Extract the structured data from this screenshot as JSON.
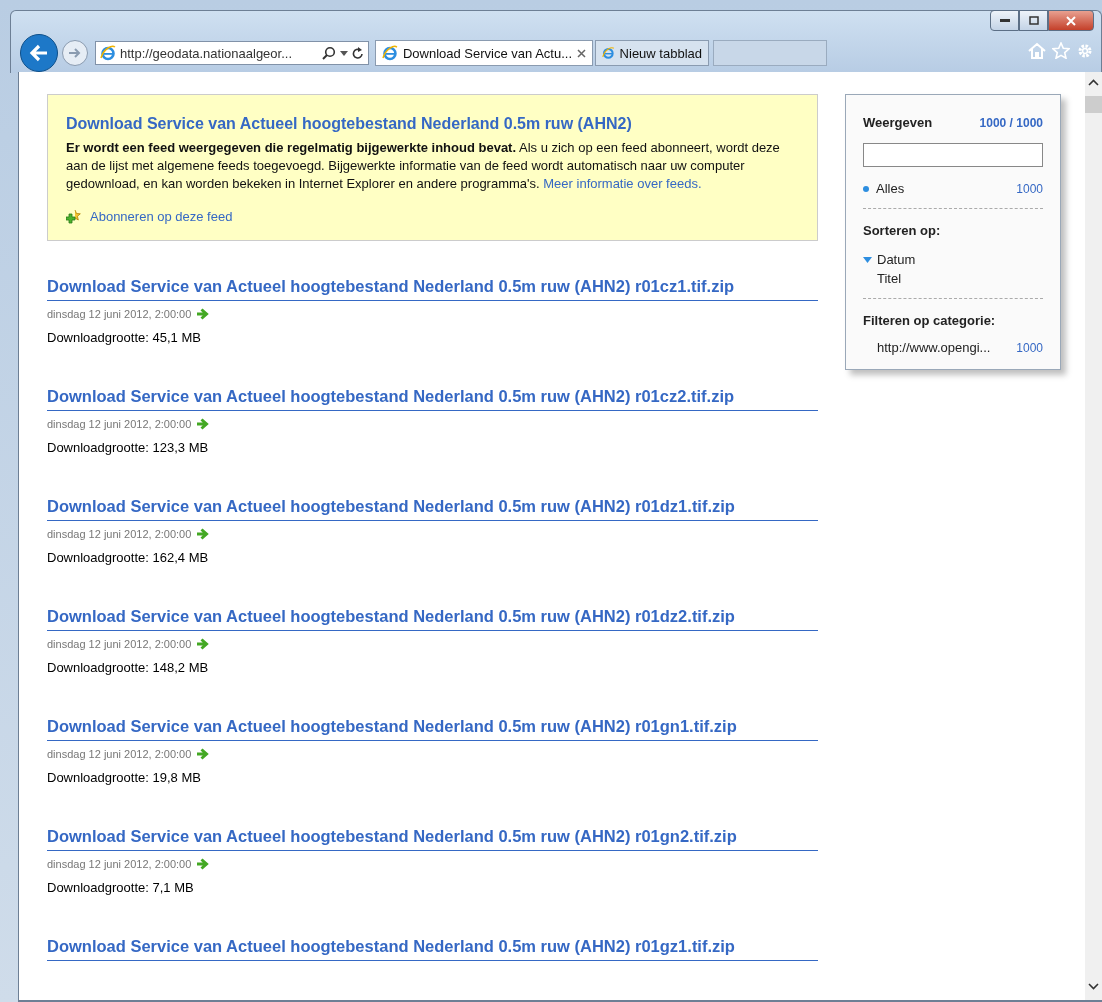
{
  "browser": {
    "address": "http://geodata.nationaalgeor...",
    "tabs": [
      {
        "label": "Download Service van Actu...",
        "selected": true
      },
      {
        "label": "Nieuw tabblad",
        "selected": false
      }
    ]
  },
  "feed": {
    "title": "Download Service van Actueel hoogtebestand Nederland 0.5m ruw (AHN2)",
    "notice": "**Er wordt een feed weergegeven die regelmatig bijgewerkte inhoud bevat.** Als u zich op een feed abonneert, wordt deze aan de lijst met algemene feeds toegevoegd. Bijgewerkte informatie van de feed wordt automatisch naar uw computer gedownload, en kan worden bekeken in Internet Explorer en andere programma's.",
    "more_link": "Meer informatie over feeds.",
    "subscribe_link": "Abonneren op deze feed"
  },
  "entries": [
    {
      "title": "Download Service van Actueel hoogtebestand Nederland 0.5m ruw (AHN2) r01cz1.tif.zip",
      "date": "dinsdag 12 juni 2012, 2:00:00",
      "size": "Downloadgrootte: 45,1 MB"
    },
    {
      "title": "Download Service van Actueel hoogtebestand Nederland 0.5m ruw (AHN2) r01cz2.tif.zip",
      "date": "dinsdag 12 juni 2012, 2:00:00",
      "size": "Downloadgrootte: 123,3 MB"
    },
    {
      "title": "Download Service van Actueel hoogtebestand Nederland 0.5m ruw (AHN2) r01dz1.tif.zip",
      "date": "dinsdag 12 juni 2012, 2:00:00",
      "size": "Downloadgrootte: 162,4 MB"
    },
    {
      "title": "Download Service van Actueel hoogtebestand Nederland 0.5m ruw (AHN2) r01dz2.tif.zip",
      "date": "dinsdag 12 juni 2012, 2:00:00",
      "size": "Downloadgrootte: 148,2 MB"
    },
    {
      "title": "Download Service van Actueel hoogtebestand Nederland 0.5m ruw (AHN2) r01gn1.tif.zip",
      "date": "dinsdag 12 juni 2012, 2:00:00",
      "size": "Downloadgrootte: 19,8 MB"
    },
    {
      "title": "Download Service van Actueel hoogtebestand Nederland 0.5m ruw (AHN2) r01gn2.tif.zip",
      "date": "dinsdag 12 juni 2012, 2:00:00",
      "size": "Downloadgrootte: 7,1 MB"
    },
    {
      "title": "Download Service van Actueel hoogtebestand Nederland 0.5m ruw (AHN2) r01gz1.tif.zip"
    }
  ],
  "sidebar": {
    "show_label": "Weergeven",
    "show_count": "1000 / 1000",
    "filters": [
      {
        "label": "Alles",
        "count": "1000",
        "selected": true
      }
    ],
    "sort_label": "Sorteren op:",
    "sort_options": [
      {
        "label": "Datum",
        "selected": true
      },
      {
        "label": "Titel",
        "selected": false
      }
    ],
    "category_label": "Filteren op categorie:",
    "categories": [
      {
        "label": "http://www.opengi...",
        "count": "1000"
      }
    ]
  }
}
